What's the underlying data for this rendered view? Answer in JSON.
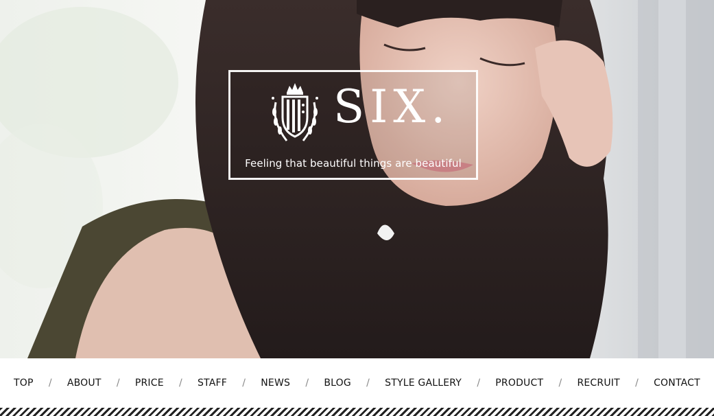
{
  "hero": {
    "image": "portrait-woman-dark-hair",
    "colors": {
      "background_left": "#eef0ec",
      "hair": "#2b2120",
      "top": "#4a4632",
      "skin": "#e6c3b6",
      "background_right": "#c5c8cc"
    }
  },
  "logo": {
    "wordmark": "SIX.",
    "tagline": "Feeling that beautiful things are beautiful",
    "emblem": "crest-with-crown-and-laurel-icon"
  },
  "nav": {
    "items": [
      {
        "label": "TOP"
      },
      {
        "label": "ABOUT"
      },
      {
        "label": "PRICE"
      },
      {
        "label": "STAFF"
      },
      {
        "label": "NEWS"
      },
      {
        "label": "BLOG"
      },
      {
        "label": "STYLE GALLERY"
      },
      {
        "label": "PRODUCT"
      },
      {
        "label": "RECRUIT"
      },
      {
        "label": "CONTACT"
      }
    ],
    "separator": "/"
  }
}
